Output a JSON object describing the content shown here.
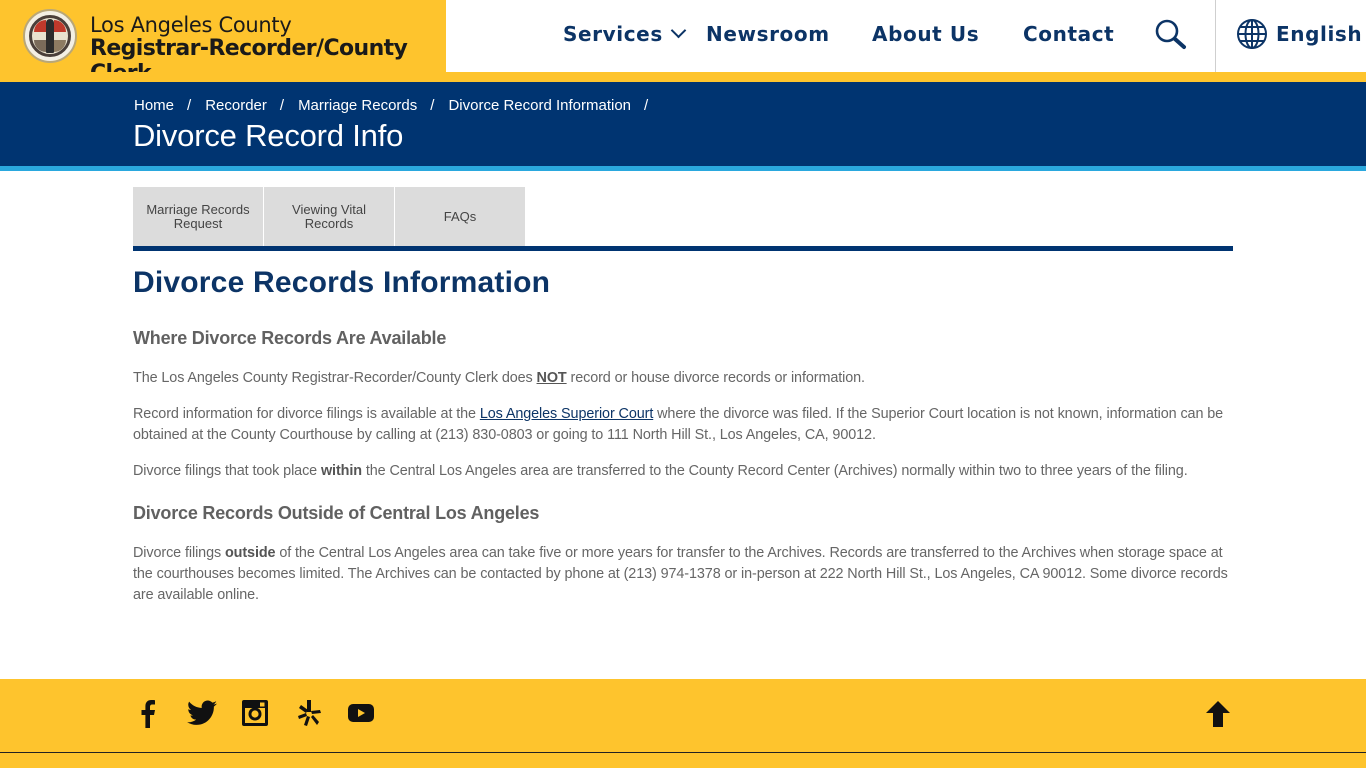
{
  "header": {
    "brand_line1": "Los Angeles County",
    "brand_line2": "Registrar-Recorder/County Clerk",
    "logo": "county-seal-icon",
    "nav": [
      {
        "label": "Services",
        "has_dropdown": true
      },
      {
        "label": "Newsroom"
      },
      {
        "label": "About Us"
      },
      {
        "label": "Contact"
      }
    ],
    "search_icon": "search-icon",
    "language": {
      "icon": "globe-icon",
      "label": "English"
    }
  },
  "banner": {
    "breadcrumb": [
      "Home",
      "Recorder",
      "Marriage Records",
      "Divorce Record Information"
    ],
    "separator": "/",
    "title": "Divorce Record Info"
  },
  "tabs": [
    {
      "label": "Marriage Records Request"
    },
    {
      "label": "Viewing Vital Records"
    },
    {
      "label": "FAQs"
    }
  ],
  "content": {
    "heading": "Divorce Records Information",
    "section1": {
      "title": "Where Divorce Records Are Available",
      "p1": {
        "before": "The Los Angeles County Registrar-Recorder/County Clerk does ",
        "emphasis": "NOT",
        "after": " record or house divorce records or information."
      },
      "p2": {
        "before": "Record information for divorce filings is available at the ",
        "link": "Los Angeles Superior Court",
        "after": " where the divorce was filed. If the Superior Court location is not known, information can be obtained at the County Courthouse by calling at (213) 830-0803 or going to 111 North Hill St., Los Angeles, CA, 90012."
      },
      "p3": {
        "before": "Divorce filings that took place ",
        "emphasis": "within",
        "after": " the Central Los Angeles area are transferred to the County Record Center (Archives) normally within two to three years of the filing."
      }
    },
    "section2": {
      "title": "Divorce Records Outside of Central Los Angeles",
      "p1": {
        "before": "Divorce filings ",
        "emphasis": "outside",
        "after": " of the Central Los Angeles area can take five or more years for transfer to the Archives. Records are transferred to the Archives when storage space at the courthouses becomes limited. The Archives can be contacted by phone at (213) 974-1378 or in-person at 222 North Hill St., Los Angeles, CA 90012. Some divorce records are available online."
      }
    }
  },
  "footer": {
    "social": [
      "facebook-icon",
      "twitter-icon",
      "instagram-icon",
      "yelp-icon",
      "youtube-icon"
    ],
    "back_to_top_icon": "arrow-up-icon"
  },
  "colors": {
    "brand_yellow": "#FEC42D",
    "brand_navy": "#003471",
    "accent_blue": "#2AA8DE",
    "tab_gray": "#DCDCDC"
  }
}
